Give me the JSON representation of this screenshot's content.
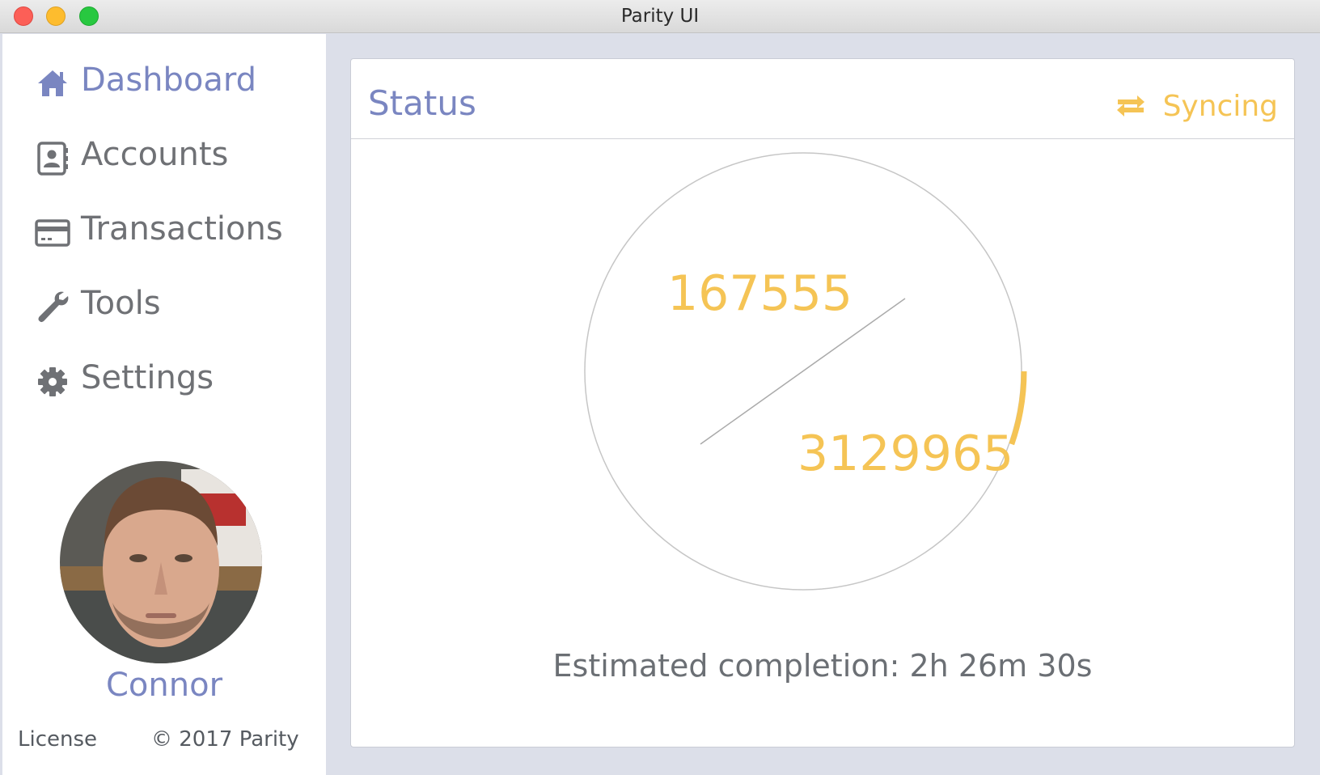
{
  "window": {
    "title": "Parity UI"
  },
  "sidebar": {
    "items": [
      {
        "label": "Dashboard",
        "icon": "home-icon",
        "active": true
      },
      {
        "label": "Accounts",
        "icon": "contact-card-icon",
        "active": false
      },
      {
        "label": "Transactions",
        "icon": "credit-card-icon",
        "active": false
      },
      {
        "label": "Tools",
        "icon": "wrench-icon",
        "active": false
      },
      {
        "label": "Settings",
        "icon": "gear-icon",
        "active": false
      }
    ],
    "user": {
      "name": "Connor"
    },
    "footer": {
      "license_label": "License",
      "copyright": "© 2017 Parity"
    }
  },
  "status_card": {
    "title": "Status",
    "sync_label": "Syncing",
    "current_block": "167555",
    "highest_block": "3129965",
    "progress_fraction": 0.0535,
    "eta_prefix": "Estimated completion: ",
    "eta_value": "2h 26m 30s"
  },
  "colors": {
    "accent": "#7a86c1",
    "sync": "#f5c455",
    "text": "#6f7175",
    "background": "#dcdfe9"
  }
}
